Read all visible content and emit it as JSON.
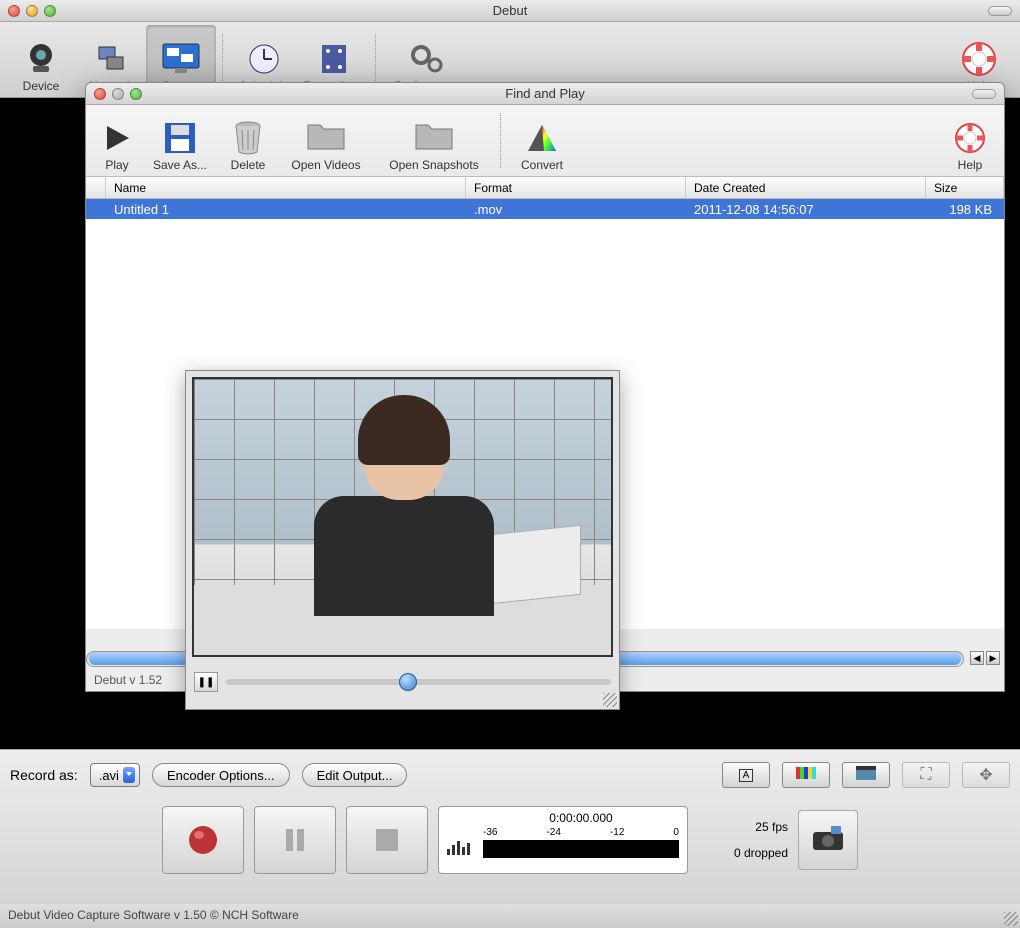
{
  "main": {
    "title": "Debut",
    "toolbar": {
      "device": "Device",
      "network": "Network",
      "screen": "Screen",
      "schedule": "Schedule",
      "recordings": "Recordings",
      "preferences": "Preferences",
      "help": "Help"
    },
    "recordAsLabel": "Record as:",
    "recordFormat": ".avi",
    "encoderOptions": "Encoder Options...",
    "editOutput": "Edit Output...",
    "timer": "0:00:00.000",
    "levels": [
      "-36",
      "-24",
      "-12",
      "0"
    ],
    "fps": "25 fps",
    "dropped": "0 dropped",
    "footer": "Debut Video Capture Software v 1.50 © NCH Software"
  },
  "findPlay": {
    "title": "Find and Play",
    "toolbar": {
      "play": "Play",
      "saveAs": "Save As...",
      "delete": "Delete",
      "openVideos": "Open Videos",
      "openSnapshots": "Open Snapshots",
      "convert": "Convert",
      "help": "Help"
    },
    "columns": {
      "name": "Name",
      "format": "Format",
      "date": "Date Created",
      "size": "Size"
    },
    "row": {
      "name": "Untitled 1",
      "format": ".mov",
      "date": "2011-12-08 14:56:07",
      "size": "198 KB"
    },
    "status": "Debut v 1.52"
  }
}
